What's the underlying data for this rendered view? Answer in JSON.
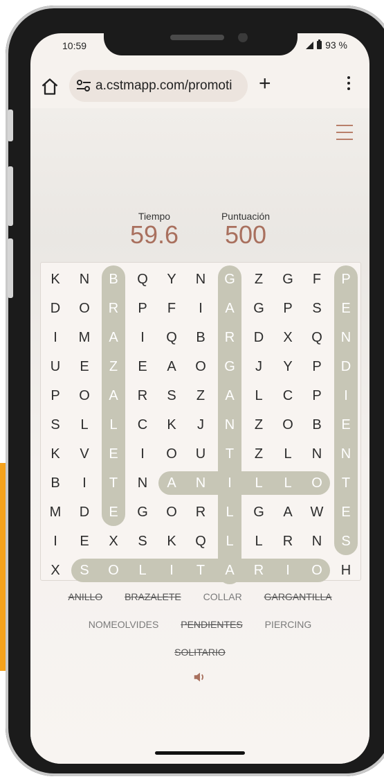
{
  "status_bar": {
    "time": "10:59",
    "battery": "93 %"
  },
  "browser": {
    "url": "a.cstmapp.com/promoti",
    "new_tab_label": "+"
  },
  "game": {
    "time_label": "Tiempo",
    "time_value": "59.6",
    "score_label": "Puntuación",
    "score_value": "500"
  },
  "grid": [
    [
      "K",
      "N",
      "B",
      "Q",
      "Y",
      "N",
      "G",
      "Z",
      "G",
      "F",
      "P"
    ],
    [
      "D",
      "O",
      "R",
      "P",
      "F",
      "I",
      "A",
      "G",
      "P",
      "S",
      "E"
    ],
    [
      "I",
      "M",
      "A",
      "I",
      "Q",
      "B",
      "R",
      "D",
      "X",
      "Q",
      "N"
    ],
    [
      "U",
      "E",
      "Z",
      "E",
      "A",
      "O",
      "G",
      "J",
      "Y",
      "P",
      "D"
    ],
    [
      "P",
      "O",
      "A",
      "R",
      "S",
      "Z",
      "A",
      "L",
      "C",
      "P",
      "I"
    ],
    [
      "S",
      "L",
      "L",
      "C",
      "K",
      "J",
      "N",
      "Z",
      "O",
      "B",
      "E"
    ],
    [
      "K",
      "V",
      "E",
      "I",
      "O",
      "U",
      "T",
      "Z",
      "L",
      "N",
      "N"
    ],
    [
      "B",
      "I",
      "T",
      "N",
      "A",
      "N",
      "I",
      "L",
      "L",
      "O",
      "T"
    ],
    [
      "M",
      "D",
      "E",
      "G",
      "O",
      "R",
      "L",
      "G",
      "A",
      "W",
      "E"
    ],
    [
      "I",
      "E",
      "X",
      "S",
      "K",
      "Q",
      "L",
      "L",
      "R",
      "N",
      "S"
    ],
    [
      "X",
      "S",
      "O",
      "L",
      "I",
      "T",
      "A",
      "R",
      "I",
      "O",
      "H"
    ]
  ],
  "found_words": [
    {
      "word": "BRAZALETE",
      "row": 0,
      "col": 2,
      "dir": "down",
      "length": 9
    },
    {
      "word": "GARGANTILLA",
      "row": 0,
      "col": 6,
      "dir": "down",
      "length": 11
    },
    {
      "word": "PENDIENTES",
      "row": 0,
      "col": 10,
      "dir": "down",
      "length": 10
    },
    {
      "word": "ANILLO",
      "row": 7,
      "col": 4,
      "dir": "right",
      "length": 6
    },
    {
      "word": "SOLITARIO",
      "row": 10,
      "col": 1,
      "dir": "right",
      "length": 9
    }
  ],
  "word_list": [
    {
      "label": "ANILLO",
      "found": true
    },
    {
      "label": "BRAZALETE",
      "found": true
    },
    {
      "label": "COLLAR",
      "found": false
    },
    {
      "label": "GARGANTILLA",
      "found": true
    },
    {
      "label": "NOMEOLVIDES",
      "found": false
    },
    {
      "label": "PENDIENTES",
      "found": true
    },
    {
      "label": "PIERCING",
      "found": false
    },
    {
      "label": "SOLITARIO",
      "found": true
    }
  ],
  "colors": {
    "highlight": "#c7c6b6",
    "accent": "#a9705e",
    "orange": "#f5a21c"
  },
  "icons": [
    "home-icon",
    "site-settings-icon",
    "menu-icon",
    "more-vertical-icon",
    "speaker-icon"
  ]
}
